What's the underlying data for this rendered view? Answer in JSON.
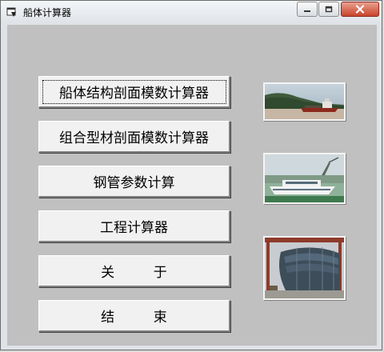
{
  "window": {
    "title": "船体计算器",
    "icon": "app-window-icon"
  },
  "title_controls": {
    "minimize_icon": "minimize-icon",
    "maximize_icon": "maximize-icon",
    "close_icon": "close-icon"
  },
  "buttons": {
    "section_modulus": "船体结构剖面模数计算器",
    "composite_profile": "组合型材剖面模数计算器",
    "steel_pipe": "钢管参数计算",
    "engineering_calc": "工程计算器",
    "about": "关         于",
    "exit": "结         束"
  },
  "images": [
    {
      "name": "cargo-ship-photo",
      "depicts": "cargo ship at sea"
    },
    {
      "name": "ferry-photo",
      "depicts": "passenger ferry at shipyard"
    },
    {
      "name": "hull-construction-photo",
      "depicts": "hull under construction in shipyard"
    }
  ]
}
